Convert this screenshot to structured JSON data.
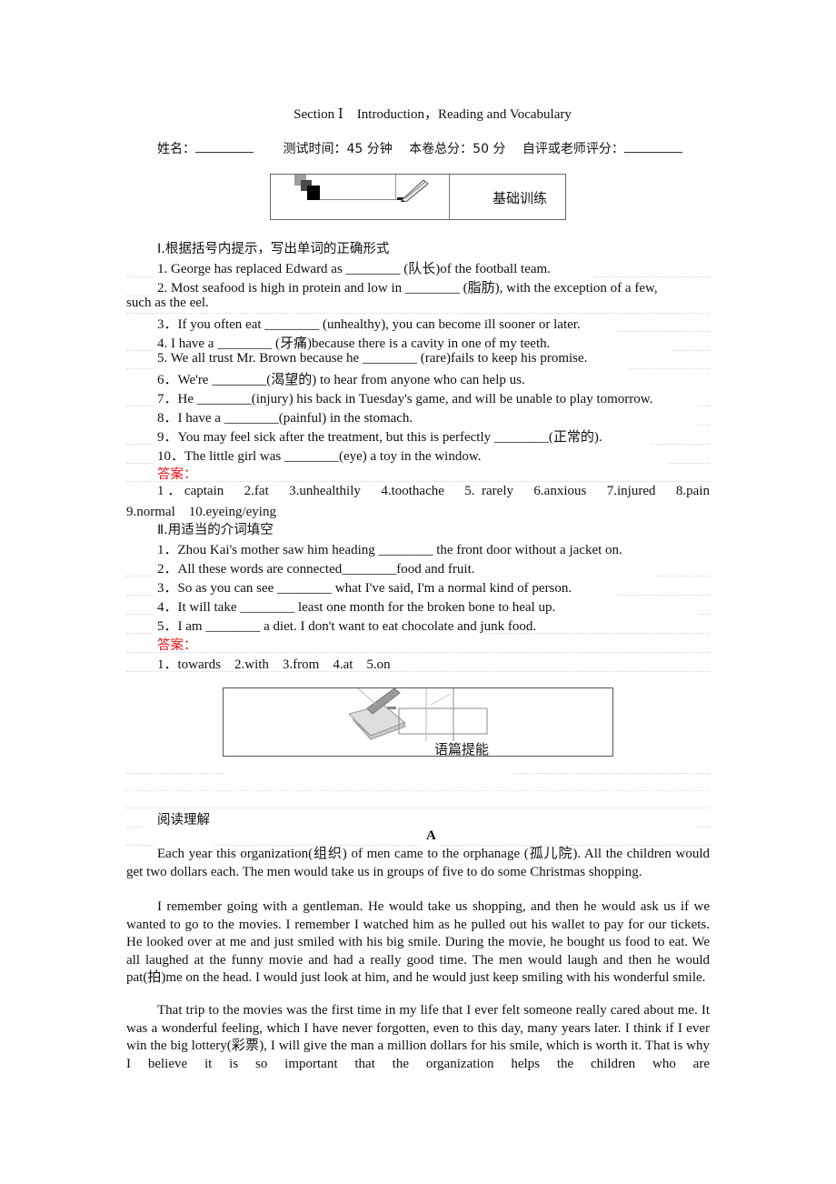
{
  "header": {
    "title": "Section Ⅰ　Introduction，Reading and Vocabulary",
    "name_label": "姓名：",
    "test_time": "测试时间：45 分钟",
    "total_score": "本卷总分：50 分",
    "grade_label": "自评或老师评分："
  },
  "banner_basic": {
    "label": "基础训练",
    "icon": "pencil-paper-icon"
  },
  "part1": {
    "heading": "Ⅰ.根据括号内提示，写出单词的正确形式",
    "questions": [
      "1. George has replaced Edward as ________ (队长)of the football team.",
      "2. Most seafood is high in protein and low in ________ (脂肪), with the exception of a few,",
      "such as the eel.",
      "3．If you often eat ________ (unhealthy), you can become ill sooner or later.",
      "4. I have a ________ (牙痛)because there is a cavity in one of my teeth.",
      "5. We all trust Mr. Brown because he ________ (rare)fails to keep his promise.",
      "6．We're ________(渴望的) to hear from anyone who can help us.",
      "7．He ________(injury) his back in Tuesday's game, and will be unable to play tomorrow.",
      "8．I have a ________(painful) in the stomach.",
      "9．You may feel sick after the treatment, but this is perfectly ________(正常的).",
      "10．The little girl was ________(eye) a toy in the window."
    ],
    "answer_label": "答案：",
    "answers_line1": "1．captain　2.fat　3.unhealthily　4.toothache　5. rarely　6.anxious　7.injured　8.pain",
    "answers_line2": "9.normal　10.eyeing/eying"
  },
  "part2": {
    "heading": "Ⅱ.用适当的介词填空",
    "questions": [
      "1．Zhou Kai's mother saw him heading ________ the front door without a jacket on.",
      "2．All these words are connected________food and fruit.",
      "3．So as you can see ________ what I've said, I'm a normal kind of person.",
      "4．It will take ________ least one month for the broken bone to heal up.",
      "5．I am ________ a diet. I don't want to eat chocolate and junk food."
    ],
    "answer_label": "答案：",
    "answers": "1．towards　2.with　3.from　4.at　5.on"
  },
  "banner_reading": {
    "label": "语篇提能",
    "icon": "book-pen-icon"
  },
  "reading": {
    "heading": "阅读理解",
    "passage_letter": "A",
    "paragraphs": [
      "Each year this organization(组织) of men came to the orphanage (孤儿院).  All the children would get two dollars each. The men would take us in groups of five to do some Christmas shopping.",
      "I remember going with a gentleman. He would take us shopping, and then he would ask us if we wanted to go to the movies. I remember I watched him as he pulled out his wallet to pay for our tickets. He looked over at me and just smiled with his big smile. During the movie, he bought us food to eat. We all laughed at the funny movie and had a really good time. The men would laugh and then he would pat(拍)me on the head. I would just look at him, and he would just keep smiling with his wonderful smile.",
      "That trip to the movies was the first time in my life that I ever felt someone really cared about me. It was a wonderful feeling, which I have never forgotten, even to this day, many years later. I think if I ever win the big lottery(彩票), I will give the man a million dollars for his smile, which is worth it. That is why I believe it is so important that the organization helps the children who are"
    ]
  }
}
